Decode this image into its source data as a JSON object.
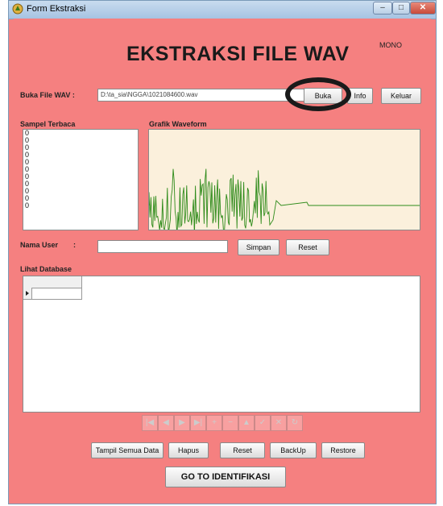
{
  "window": {
    "title": "Form Ekstraksi"
  },
  "header": {
    "title": "EKSTRAKSI FILE WAV",
    "channel_mode": "MONO"
  },
  "file": {
    "label": "Buka File WAV :",
    "path": "D:\\ta_sia\\NGGA\\1021084600.wav",
    "open_label": "Buka",
    "info_label": "Info",
    "exit_label": "Keluar"
  },
  "samples": {
    "label": "Sampel Terbaca",
    "values": [
      "0",
      "0",
      "0",
      "0",
      "0",
      "0",
      "0",
      "0",
      "0",
      "0",
      "0"
    ]
  },
  "waveform": {
    "label": "Grafik Waveform",
    "line_color": "#2e8b1a",
    "background": "#fbf0dc"
  },
  "user": {
    "label": "Nama User",
    "colon": ":",
    "value": "",
    "save_label": "Simpan",
    "reset_label": "Reset"
  },
  "database": {
    "label": "Lihat Database"
  },
  "navigator": {
    "icons": [
      "first-icon",
      "prior-icon",
      "next-icon",
      "last-icon",
      "insert-icon",
      "delete-icon",
      "edit-icon",
      "post-icon",
      "cancel-icon",
      "refresh-icon"
    ]
  },
  "actions": {
    "show_all": "Tampil Semua Data",
    "delete": "Hapus",
    "reset": "Reset",
    "backup": "BackUp",
    "restore": "Restore",
    "identify": "GO TO IDENTIFIKASI"
  },
  "colors": {
    "form_bg": "#f58080",
    "highlight_ring": "#1a1a1a"
  }
}
